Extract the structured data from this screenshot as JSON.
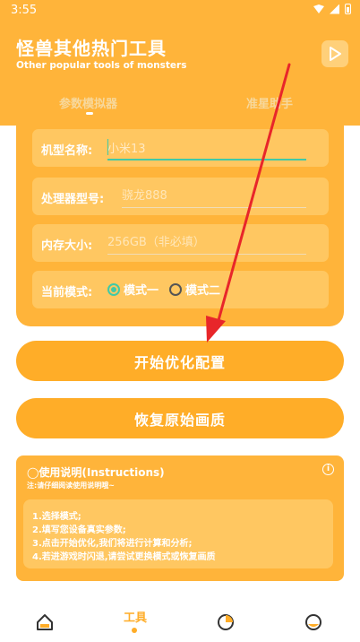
{
  "status_bar": {
    "time": "3:55"
  },
  "header": {
    "title": "怪兽其他热门工具",
    "subtitle": "Other popular tools of monsters"
  },
  "tabs": [
    {
      "label": "参数模拟器",
      "active": true
    },
    {
      "label": "准星助手",
      "active": false
    }
  ],
  "form": {
    "model": {
      "label": "机型名称:",
      "value": "小米13"
    },
    "processor": {
      "label": "处理器型号:",
      "placeholder": "骁龙888"
    },
    "memory": {
      "label": "内存大小:",
      "placeholder": "256GB（非必填）"
    },
    "mode": {
      "label": "当前模式:",
      "option1": "模式一",
      "option2": "模式二",
      "selected": "模式一"
    }
  },
  "buttons": {
    "optimize": "开始优化配置",
    "restore": "恢复原始画质"
  },
  "instructions": {
    "title": "◯使用说明(Instructions)",
    "note": "注:请仔细阅读使用说明哦~",
    "info_icon": "i",
    "steps": [
      "1.选择模式;",
      "2.填写您设备真实参数;",
      "3.点击开始优化,我们将进行计算和分析;",
      "4.若进游戏时闪退,请尝试更换模式或恢复画质"
    ]
  },
  "bottom_nav": {
    "tools_label": "工具"
  },
  "colors": {
    "primary": "#ffb43a",
    "button": "#ffad28",
    "field": "#ffc761",
    "accent": "#41c9a6",
    "arrow": "#e8262a"
  }
}
